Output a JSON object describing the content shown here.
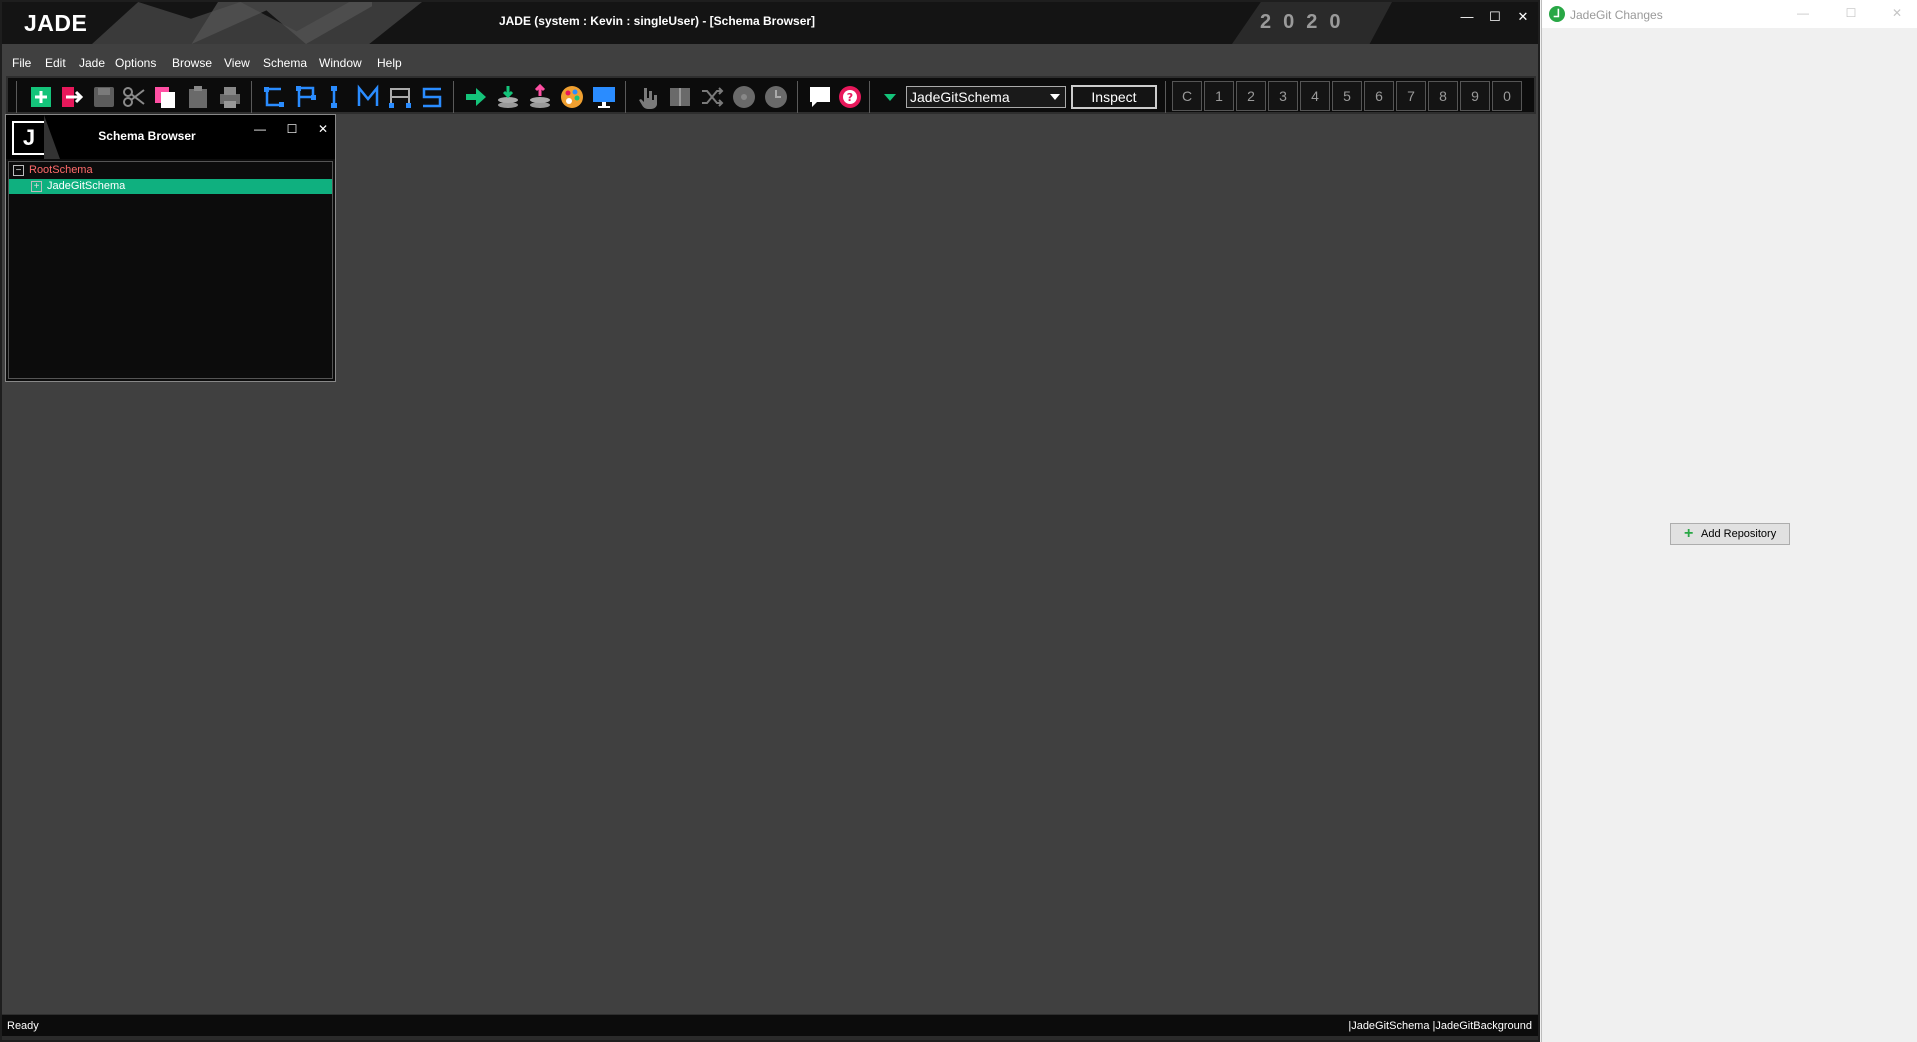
{
  "jade": {
    "logo": "JADE",
    "window_title": "JADE (system : Kevin : singleUser) - [Schema Browser]",
    "year": "2020",
    "menu": [
      "File",
      "Edit",
      "Jade",
      "Options",
      "Browse",
      "View",
      "Schema",
      "Window",
      "Help"
    ],
    "toolbar": {
      "schema_selected": "JadeGitSchema",
      "inspect_label": "Inspect",
      "number_buttons": [
        "C",
        "1",
        "2",
        "3",
        "4",
        "5",
        "6",
        "7",
        "8",
        "9",
        "0"
      ]
    },
    "schema_browser": {
      "logo": "J",
      "title": "Schema Browser",
      "tree": [
        {
          "label": "RootSchema",
          "expander": "−",
          "color": "#ff6b6b"
        },
        {
          "label": "JadeGitSchema",
          "expander": "+",
          "selected": true,
          "highlight": "#0fb07f"
        }
      ]
    },
    "status": {
      "left": "Ready",
      "right": "|JadeGitSchema |JadeGitBackground"
    }
  },
  "git_panel": {
    "title": "JadeGit Changes",
    "add_repository_label": "Add Repository"
  },
  "colors": {
    "accent_green": "#0fb07f",
    "root_schema_red": "#ff6b6b",
    "git_green": "#28a745"
  }
}
